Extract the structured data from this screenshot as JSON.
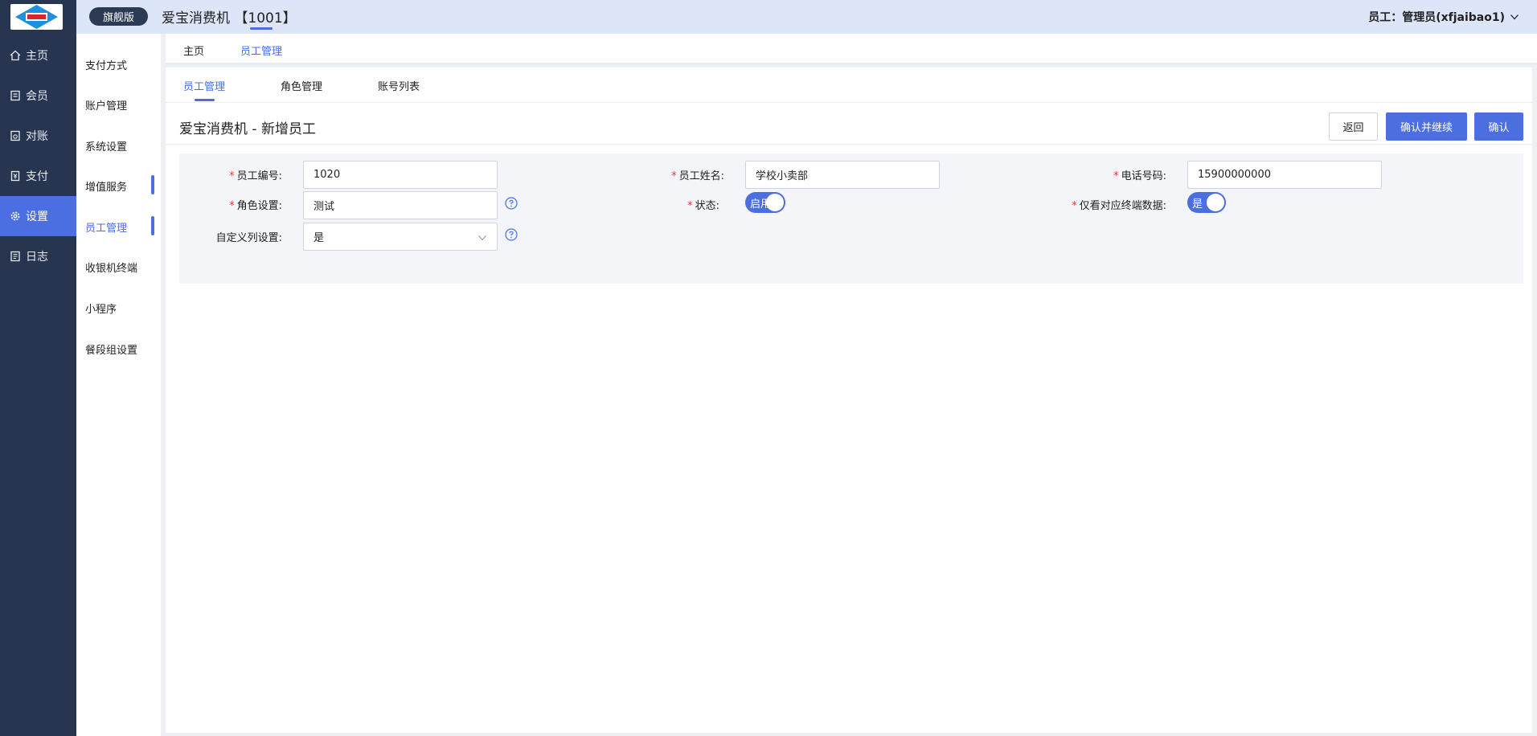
{
  "app": {
    "edition_badge": "旗舰版",
    "store_title": "爱宝消费机 【1001】",
    "user_menu": "员工：管理员(xfjaibao1)"
  },
  "colors": {
    "accent": "#4b6fe0",
    "sidebar": "#283550",
    "header": "#dde5f8"
  },
  "sidebar": {
    "items": [
      {
        "label": "主页",
        "icon": "home-icon"
      },
      {
        "label": "会员",
        "icon": "member-icon"
      },
      {
        "label": "对账",
        "icon": "reconcile-icon"
      },
      {
        "label": "支付",
        "icon": "payment-icon"
      },
      {
        "label": "设置",
        "icon": "gear-icon",
        "active": true
      },
      {
        "label": "日志",
        "icon": "log-icon"
      }
    ]
  },
  "subnav": {
    "items": [
      {
        "label": "支付方式"
      },
      {
        "label": "账户管理"
      },
      {
        "label": "系统设置"
      },
      {
        "label": "增值服务"
      },
      {
        "label": "员工管理",
        "active": true
      },
      {
        "label": "收银机终端"
      },
      {
        "label": "小程序"
      },
      {
        "label": "餐段组设置"
      }
    ]
  },
  "page_tabs": [
    {
      "label": "主页"
    },
    {
      "label": "员工管理",
      "active": true
    }
  ],
  "sub_tabs": [
    {
      "label": "员工管理",
      "active": true
    },
    {
      "label": "角色管理"
    },
    {
      "label": "账号列表"
    }
  ],
  "form": {
    "title": "爱宝消费机 - 新增员工",
    "buttons": {
      "back": "返回",
      "confirm_continue": "确认并继续",
      "confirm": "确认"
    },
    "required_mark": "*",
    "fields": {
      "employee_no": {
        "label": "员工编号:",
        "value": "1020"
      },
      "employee_name": {
        "label": "员工姓名:",
        "value": "学校小卖部"
      },
      "phone": {
        "label": "电话号码:",
        "value": "15900000000"
      },
      "role": {
        "label": "角色设置:",
        "value": "测试"
      },
      "status": {
        "label": "状态:",
        "toggle_text": "启用",
        "on": true
      },
      "terminal_only": {
        "label": "仅看对应终端数据:",
        "toggle_text": "是",
        "on": true
      },
      "custom_column": {
        "label": "自定义列设置:",
        "value": "是"
      }
    }
  }
}
